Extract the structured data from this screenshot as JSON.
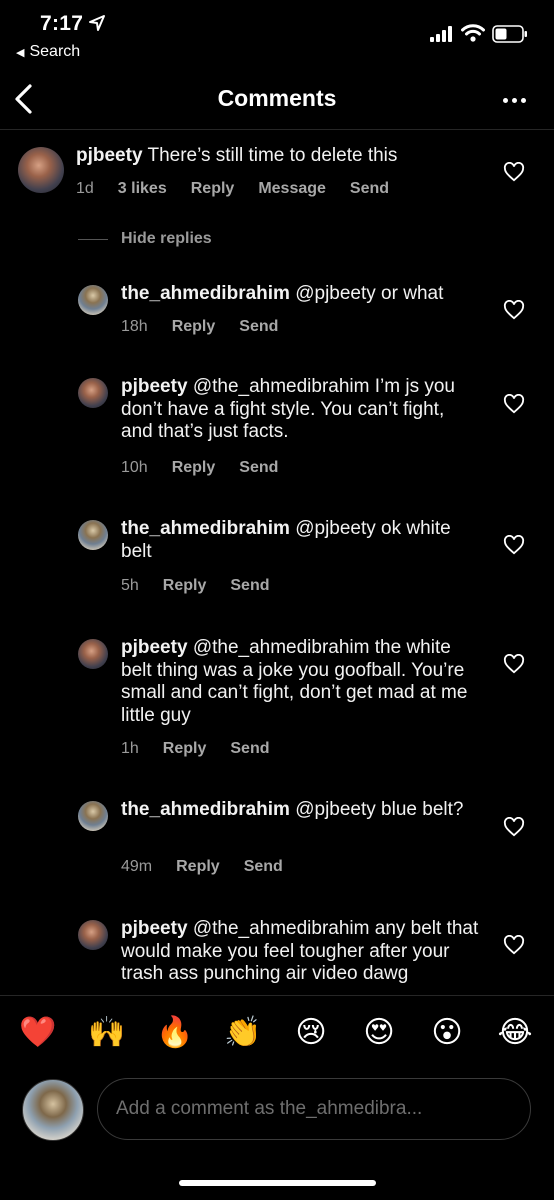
{
  "status_bar": {
    "time": "7:17",
    "back_app": "Search"
  },
  "header": {
    "title": "Comments"
  },
  "comments": [
    {
      "user": "pjbeety",
      "text": "There’s still time to delete this",
      "time": "1d",
      "likes": "3 likes",
      "actions": [
        "Reply",
        "Message",
        "Send"
      ]
    }
  ],
  "hide_replies_label": "Hide replies",
  "replies": [
    {
      "user": "the_ahmedibrahim",
      "text": "@pjbeety or what",
      "time": "18h",
      "actions": [
        "Reply",
        "Send"
      ]
    },
    {
      "user": "pjbeety",
      "text": "@the_ahmedibrahim I’m js you don’t have a fight style. You can’t fight, and that’s just facts.",
      "time": "10h",
      "actions": [
        "Reply",
        "Send"
      ]
    },
    {
      "user": "the_ahmedibrahim",
      "text": "@pjbeety ok white belt",
      "time": "5h",
      "actions": [
        "Reply",
        "Send"
      ]
    },
    {
      "user": "pjbeety",
      "text": "@the_ahmedibrahim the white belt thing was a joke you goofball. You’re small and can’t fight, don’t get mad at me little guy",
      "time": "1h",
      "actions": [
        "Reply",
        "Send"
      ]
    },
    {
      "user": "the_ahmedibrahim",
      "text": "@pjbeety blue belt?",
      "time": "49m",
      "actions": [
        "Reply",
        "Send"
      ]
    },
    {
      "user": "pjbeety",
      "text": "@the_ahmedibrahim any belt that would make you feel tougher after your trash ass punching air video dawg",
      "time": "",
      "actions": []
    }
  ],
  "emoji_bar": [
    "❤️",
    "🙌",
    "🔥",
    "👏",
    "😢",
    "😍",
    "😮",
    "😂"
  ],
  "input": {
    "placeholder": "Add a comment as the_ahmedibra..."
  }
}
